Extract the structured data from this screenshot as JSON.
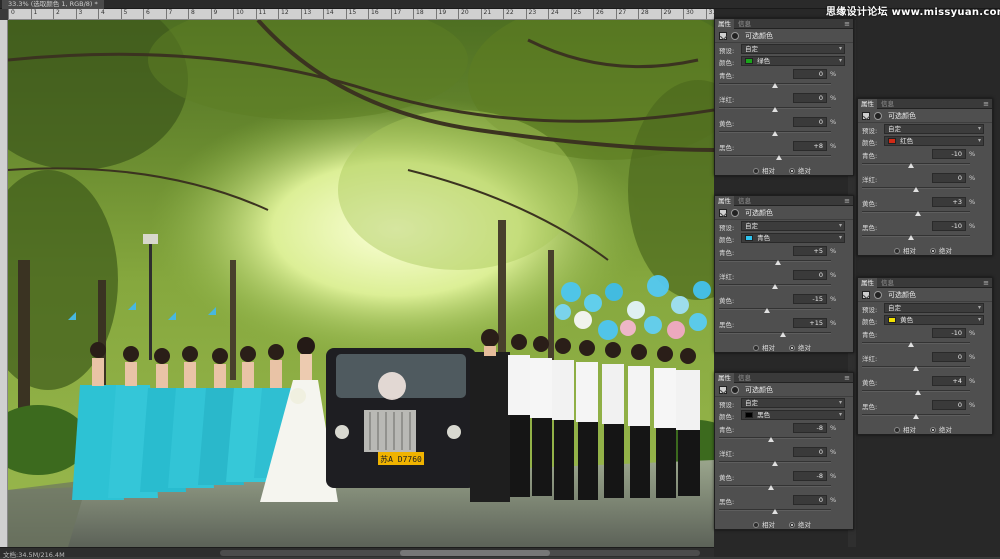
{
  "document": {
    "tab_title": "33.3% (选取颜色 1, RGB/8) *",
    "status_text": "文档:34.5M/216.4M"
  },
  "ruler": {
    "ticks": [
      "0",
      "1",
      "2",
      "3",
      "4",
      "5",
      "6",
      "7",
      "8",
      "9",
      "10",
      "11",
      "12",
      "13",
      "14",
      "15",
      "16",
      "17",
      "18",
      "19",
      "20",
      "21",
      "22",
      "23",
      "24",
      "25",
      "26",
      "27",
      "28",
      "29",
      "30",
      "31"
    ]
  },
  "photo": {
    "license_plate": "苏A D7760"
  },
  "watermark": "思缘设计论坛 www.missyuan.com",
  "common": {
    "tab_properties": "属性",
    "tab_info": "信息",
    "menu_glyph": "≡",
    "adjustment_title": "可选颜色",
    "preset_label": "预设:",
    "preset_value": "自定",
    "color_label": "颜色:",
    "label_cyan": "青色:",
    "label_magenta": "洋红:",
    "label_yellow": "黄色:",
    "label_black": "黑色:",
    "percent": "%",
    "relative": "相对",
    "absolute": "绝对",
    "dropdown_arrow": "▾"
  },
  "panels": [
    {
      "color_name": "绿色",
      "swatch": "#1aa51a",
      "values": {
        "cyan": "0",
        "magenta": "0",
        "yellow": "0",
        "black": "+8"
      },
      "positions": {
        "cyan": 0,
        "magenta": 0,
        "yellow": 0,
        "black": 8
      }
    },
    {
      "color_name": "红色",
      "swatch": "#d22a16",
      "values": {
        "cyan": "-10",
        "magenta": "0",
        "yellow": "+3",
        "black": "-10"
      },
      "positions": {
        "cyan": -10,
        "magenta": 0,
        "yellow": 3,
        "black": -10
      }
    },
    {
      "color_name": "青色",
      "swatch": "#2fc4f0",
      "values": {
        "cyan": "+5",
        "magenta": "0",
        "yellow": "-15",
        "black": "+15"
      },
      "positions": {
        "cyan": 5,
        "magenta": 0,
        "yellow": -15,
        "black": 15
      }
    },
    {
      "color_name": "黄色",
      "swatch": "#f2e200",
      "values": {
        "cyan": "-10",
        "magenta": "0",
        "yellow": "+4",
        "black": "0"
      },
      "positions": {
        "cyan": -10,
        "magenta": 0,
        "yellow": 4,
        "black": 0
      }
    },
    {
      "color_name": "黑色",
      "swatch": "#000000",
      "values": {
        "cyan": "-8",
        "magenta": "0",
        "yellow": "-8",
        "black": "0"
      },
      "positions": {
        "cyan": -8,
        "magenta": 0,
        "yellow": -8,
        "black": 0
      }
    }
  ]
}
